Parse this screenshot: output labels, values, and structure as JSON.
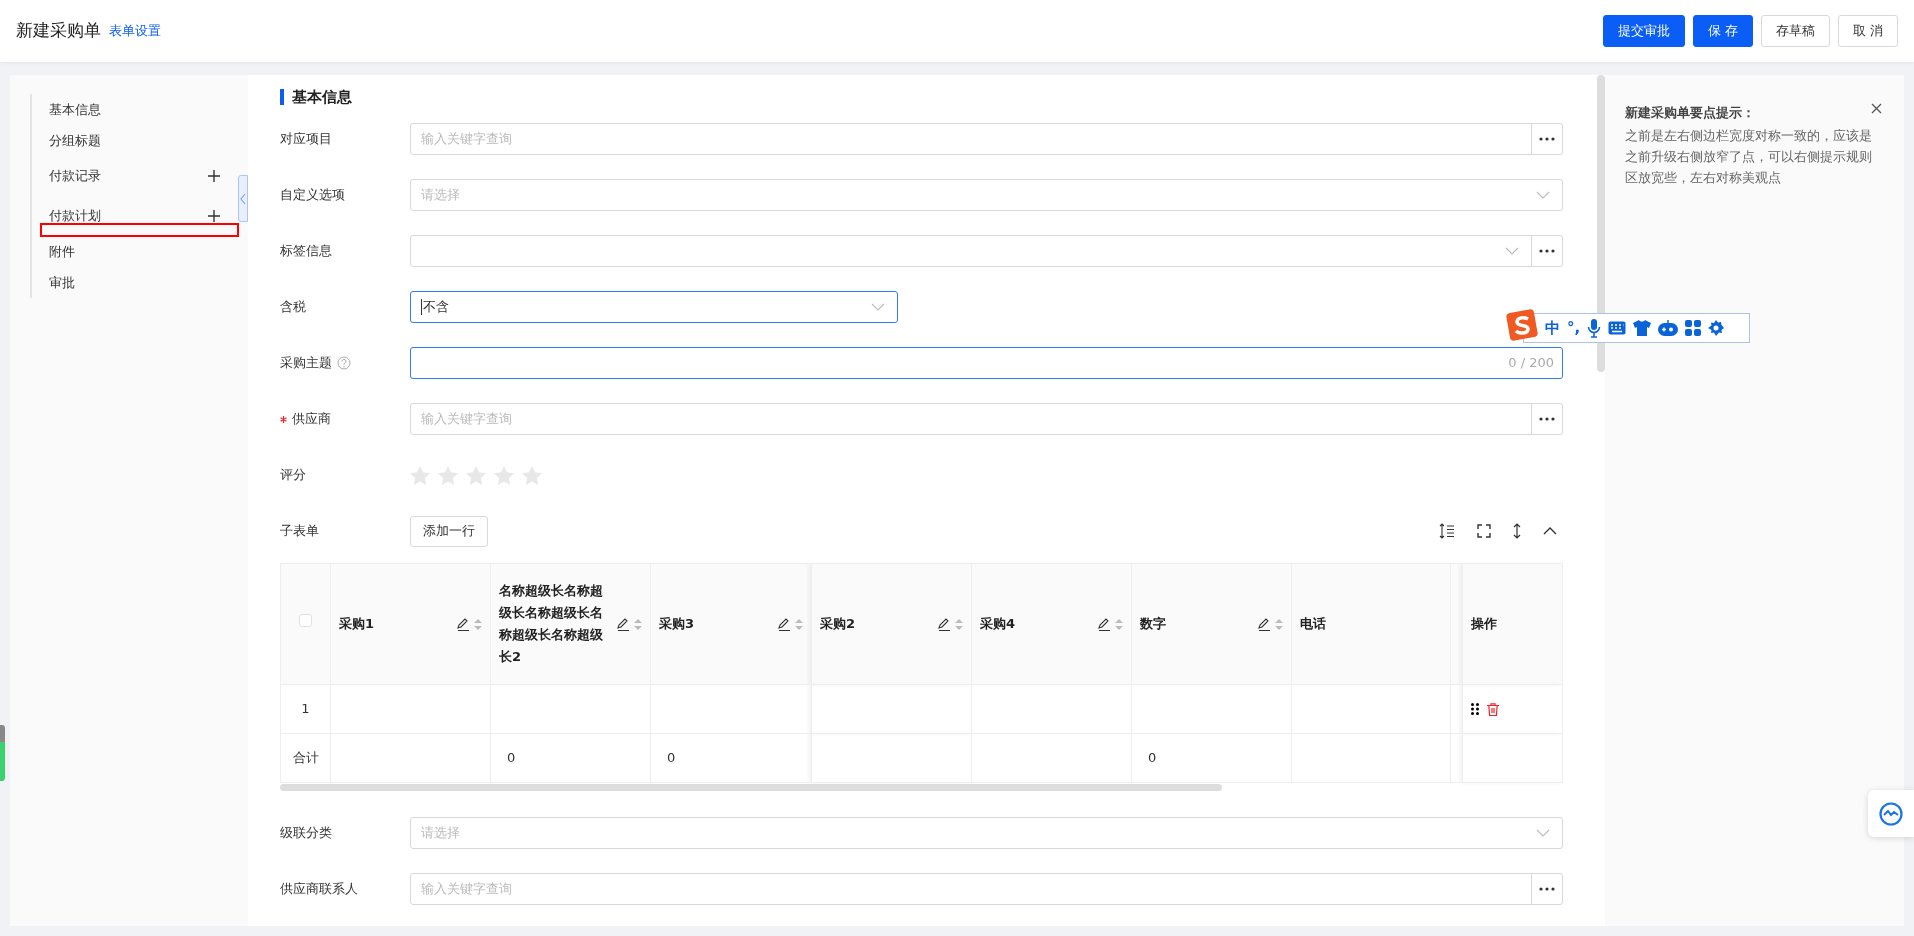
{
  "header": {
    "title": "新建采购单",
    "link": "表单设置",
    "buttons": [
      {
        "label": "提交审批",
        "kind": "primary"
      },
      {
        "label": "保 存",
        "kind": "primary"
      },
      {
        "label": "存草稿",
        "kind": "default"
      },
      {
        "label": "取 消",
        "kind": "default"
      }
    ]
  },
  "sidebar": {
    "items": [
      {
        "label": "基本信息",
        "addable": false,
        "marked": false
      },
      {
        "label": "分组标题",
        "addable": false,
        "marked": false
      },
      {
        "label": "付款记录",
        "addable": true,
        "marked": false
      },
      {
        "label": "付款计划",
        "addable": true,
        "marked": false
      },
      {
        "label": "附件",
        "addable": false,
        "marked": true
      },
      {
        "label": "审批",
        "addable": false,
        "marked": false
      }
    ]
  },
  "section_title": "基本信息",
  "fields": [
    {
      "kind": "lookup",
      "label": "对应项目",
      "placeholder": "输入关键字查询",
      "required": false,
      "help": false,
      "focused": false
    },
    {
      "kind": "select",
      "label": "自定义选项",
      "placeholder": "请选择",
      "required": false,
      "help": false,
      "focused": false
    },
    {
      "kind": "tag_lookup",
      "label": "标签信息",
      "required": false,
      "help": false,
      "focused": false
    },
    {
      "kind": "short_select",
      "label": "含税",
      "value": "不含",
      "required": false,
      "help": false,
      "focused": true
    },
    {
      "kind": "counter",
      "label": "采购主题",
      "counter": "0 / 200",
      "required": false,
      "help": true,
      "focused": true
    },
    {
      "kind": "lookup",
      "label": "供应商",
      "placeholder": "输入关键字查询",
      "required": true,
      "help": false,
      "focused": false
    },
    {
      "kind": "rating",
      "label": "评分",
      "stars": 0,
      "required": false,
      "help": false
    },
    {
      "kind": "subform",
      "label": "子表单",
      "button": "添加一行",
      "required": false,
      "help": false,
      "table": {
        "columns": [
          {
            "kind": "checkbox",
            "checked": false
          },
          {
            "kind": "data",
            "label": "采购1",
            "editable": true,
            "sortable": true
          },
          {
            "kind": "data",
            "label": "名称超级长名称超级长名称超级长名称超级长名称超级长2",
            "editable": true,
            "sortable": true
          },
          {
            "kind": "data",
            "label": "采购3",
            "editable": true,
            "sortable": true
          },
          {
            "kind": "data",
            "label": "采购2",
            "editable": true,
            "sortable": true
          },
          {
            "kind": "data",
            "label": "采购4",
            "editable": true,
            "sortable": true
          },
          {
            "kind": "data",
            "label": "数字",
            "editable": true,
            "sortable": true
          },
          {
            "kind": "data",
            "label": "电话",
            "editable": false,
            "sortable": false
          },
          {
            "kind": "clipped"
          },
          {
            "kind": "action",
            "label": "操作"
          }
        ],
        "rows": [
          {
            "kind": "data",
            "cells": [
              "1",
              null,
              null,
              null,
              null,
              null,
              null,
              null,
              null
            ]
          },
          {
            "kind": "total",
            "cells": [
              "合计",
              null,
              "0",
              "0",
              null,
              null,
              "0",
              null,
              null
            ]
          }
        ]
      }
    },
    {
      "kind": "select",
      "label": "级联分类",
      "placeholder": "请选择",
      "required": false,
      "help": false,
      "focused": false
    },
    {
      "kind": "lookup",
      "label": "供应商联系人",
      "placeholder": "输入关键字查询",
      "required": false,
      "help": false,
      "focused": false
    }
  ],
  "tips": {
    "title": "新建采购单要点提示：",
    "text": "之前是左右侧边栏宽度对称一致的，应该是之前升级右侧放窄了点，可以右侧提示规则区放宽些，左右对称美观点"
  },
  "ime_toolbar": {
    "items": [
      {
        "kind": "logo"
      },
      {
        "kind": "text",
        "label": "中"
      },
      {
        "kind": "text",
        "label": "°,"
      },
      {
        "kind": "mic"
      },
      {
        "kind": "keyboard"
      },
      {
        "kind": "skin"
      },
      {
        "kind": "robot"
      },
      {
        "kind": "apps"
      },
      {
        "kind": "settings"
      }
    ]
  }
}
